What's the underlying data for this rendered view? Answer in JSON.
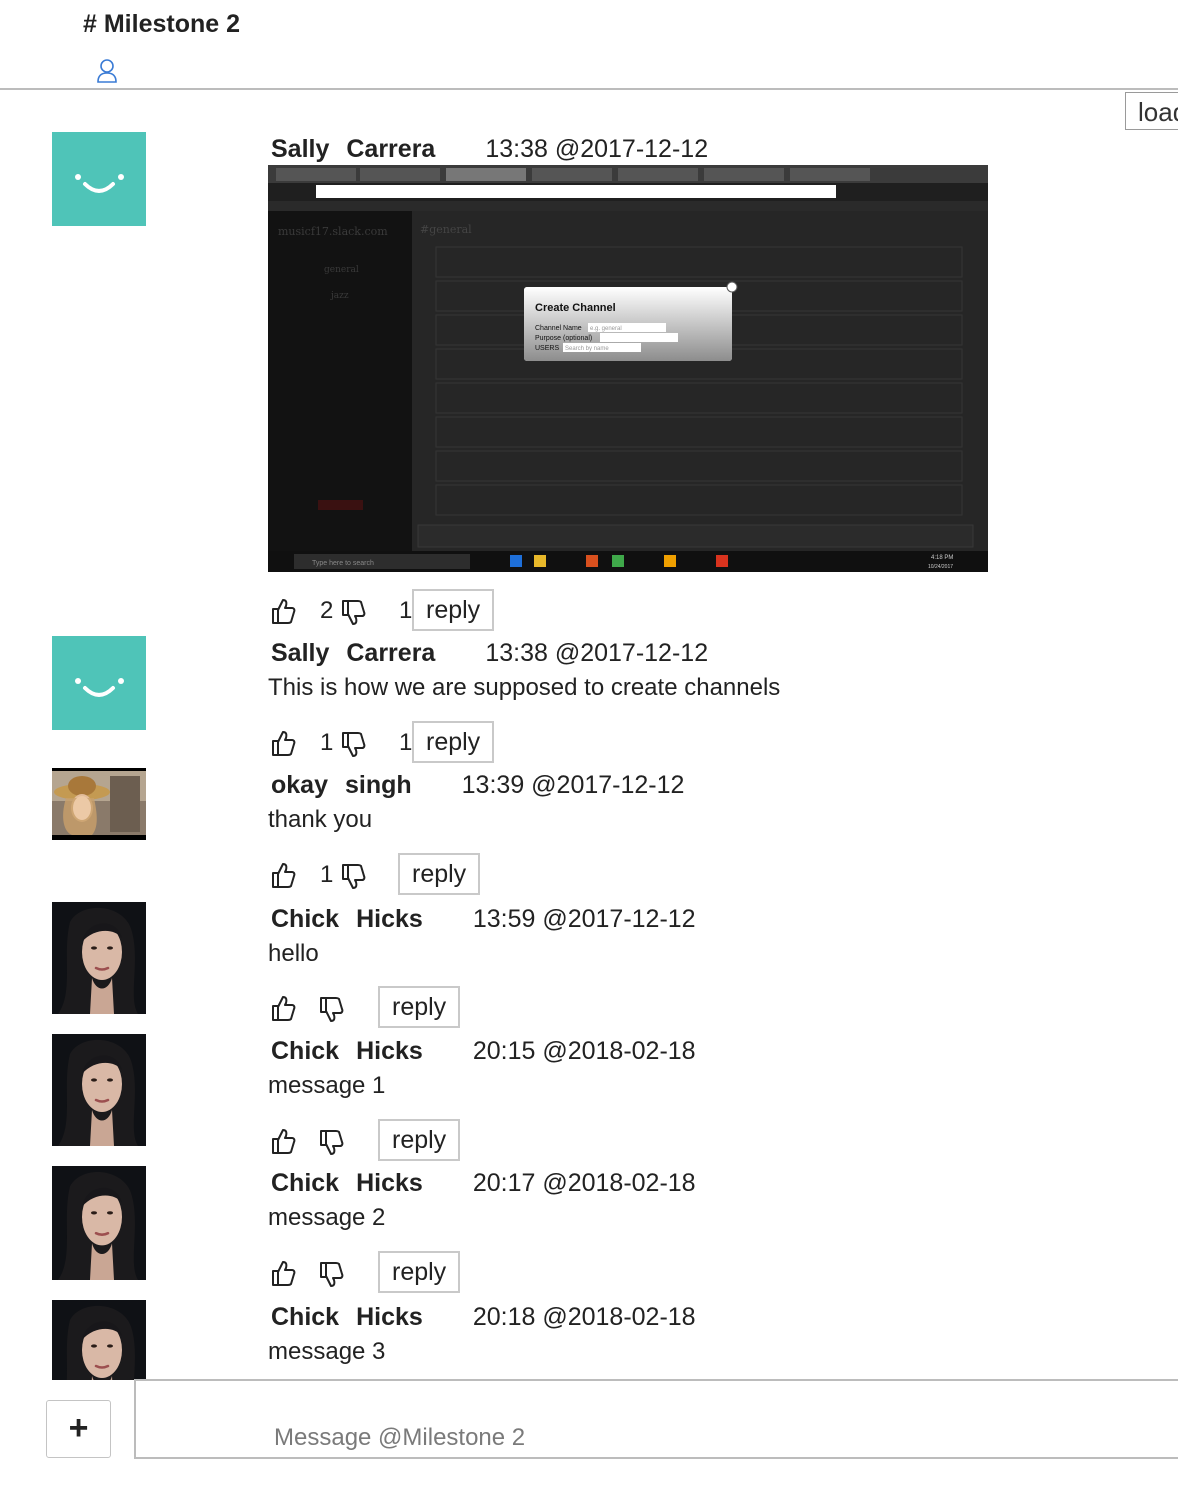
{
  "channel": {
    "title": "# Milestone 2",
    "members_icon": "user-outline-icon",
    "load_button_label": "load"
  },
  "messages": [
    {
      "first_name": "Sally",
      "last_name": "Carrera",
      "timestamp": "13:38 @2017-12-12",
      "avatar": "teal-smiley-avatar",
      "text": "",
      "attachment": "screenshot-create-channel",
      "likes": "2",
      "dislikes": "1",
      "reply_label": "reply"
    },
    {
      "first_name": "Sally",
      "last_name": "Carrera",
      "timestamp": "13:38 @2017-12-12",
      "avatar": "teal-smiley-avatar",
      "text": "This is how we are supposed to create channels",
      "likes": "1",
      "dislikes": "1",
      "reply_label": "reply"
    },
    {
      "first_name": "okay",
      "last_name": "singh",
      "timestamp": "13:39 @2017-12-12",
      "avatar": "photo-woman-hat-avatar",
      "text": "thank you",
      "likes": "1",
      "dislikes": "",
      "reply_label": "reply"
    },
    {
      "first_name": "Chick",
      "last_name": "Hicks",
      "timestamp": "13:59 @2017-12-12",
      "avatar": "photo-woman-portrait-avatar",
      "text": "hello",
      "likes": "",
      "dislikes": "",
      "reply_label": "reply"
    },
    {
      "first_name": "Chick",
      "last_name": "Hicks",
      "timestamp": "20:15 @2018-02-18",
      "avatar": "photo-woman-portrait-avatar",
      "text": "message 1",
      "likes": "",
      "dislikes": "",
      "reply_label": "reply"
    },
    {
      "first_name": "Chick",
      "last_name": "Hicks",
      "timestamp": "20:17 @2018-02-18",
      "avatar": "photo-woman-portrait-avatar",
      "text": "message 2",
      "likes": "",
      "dislikes": "",
      "reply_label": "reply"
    },
    {
      "first_name": "Chick",
      "last_name": "Hicks",
      "timestamp": "20:18 @2018-02-18",
      "avatar": "photo-woman-portrait-avatar",
      "text": "message 3"
    }
  ],
  "attachment_screenshot": {
    "workspace": "musicf17.slack.com",
    "channel_header": "#general",
    "sidebar_channels": [
      "general",
      "jazz"
    ],
    "modal_title": "Create Channel",
    "modal_fields": [
      {
        "label": "Channel Name",
        "placeholder": "e.g. general"
      },
      {
        "label": "Purpose (optional)",
        "placeholder": ""
      },
      {
        "label": "USERS",
        "placeholder": "Search by name"
      }
    ],
    "taskbar_search": "Type here to search",
    "clock": "4:18 PM",
    "date": "10/24/2017"
  },
  "composer": {
    "add_button_label": "+",
    "placeholder": "Message @Milestone 2"
  }
}
